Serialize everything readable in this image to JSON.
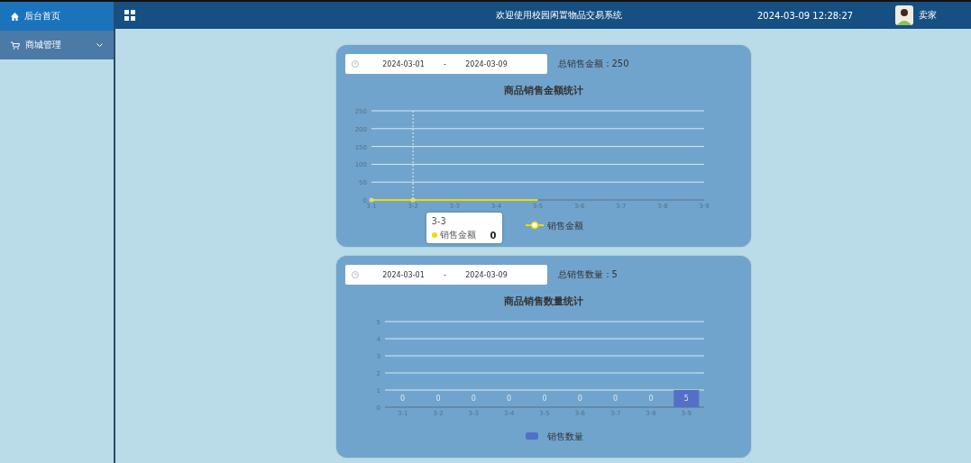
{
  "sidebar": {
    "items": [
      {
        "label": "后台首页",
        "selected": true,
        "expandable": false
      },
      {
        "label": "商城管理",
        "selected": false,
        "expandable": true
      }
    ]
  },
  "header": {
    "title": "欢迎使用校园闲置物品交易系统",
    "datetime": "2024-03-09 12:28:27",
    "user": "卖家"
  },
  "panels": [
    {
      "date_start": "2024-03-01",
      "date_separator": "-",
      "date_end": "2024-03-09",
      "total_label": "总销售金额：",
      "total_value": "250",
      "tooltip": {
        "title": "3-3",
        "series": "销售金额",
        "value": "0",
        "color": "#f5d800"
      },
      "chart_data": {
        "type": "line",
        "title": "商品销售金额统计",
        "categories": [
          "3-1",
          "3-2",
          "3-3",
          "3-4",
          "3-5",
          "3-6",
          "3-7",
          "3-8",
          "3-9"
        ],
        "ylim": [
          0,
          250
        ],
        "yticks": [
          0,
          50,
          100,
          150,
          200,
          250
        ],
        "grid": true,
        "ref_lines": [
          {
            "axis": "x",
            "value": "3-2"
          }
        ],
        "series": [
          {
            "name": "销售金额",
            "color": "#f5d800",
            "values": [
              0,
              0,
              0,
              0,
              0,
              null,
              null,
              null,
              null
            ]
          }
        ]
      }
    },
    {
      "date_start": "2024-03-01",
      "date_separator": "-",
      "date_end": "2024-03-09",
      "total_label": "总销售数量：",
      "total_value": "5",
      "chart_data": {
        "type": "bar",
        "title": "商品销售数量统计",
        "categories": [
          "3-1",
          "3-2",
          "3-3",
          "3-4",
          "3-5",
          "3-6",
          "3-7",
          "3-8",
          "3-9"
        ],
        "ylim": [
          0,
          5
        ],
        "yticks": [
          0,
          1,
          2,
          3,
          4,
          5
        ],
        "grid": true,
        "series": [
          {
            "name": "销售数量",
            "color": "#5470c6",
            "values": [
              0,
              0,
              0,
              0,
              0,
              0,
              0,
              0,
              1
            ]
          }
        ],
        "value_labels": [
          "0",
          "0",
          "0",
          "0",
          "0",
          "0",
          "0",
          "0",
          "5"
        ]
      }
    }
  ]
}
